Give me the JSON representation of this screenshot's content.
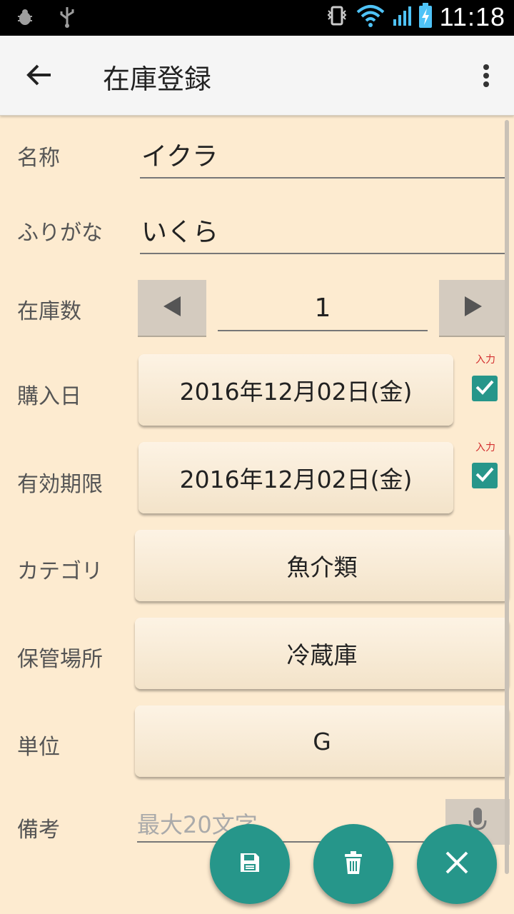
{
  "status_bar": {
    "time": "11:18"
  },
  "app_bar": {
    "title": "在庫登録"
  },
  "form": {
    "name": {
      "label": "名称",
      "value": "イクラ"
    },
    "furigana": {
      "label": "ふりがな",
      "value": "いくら"
    },
    "stock": {
      "label": "在庫数",
      "value": "1"
    },
    "purchase_date": {
      "label": "購入日",
      "value": "2016年12月02日(金)",
      "input_label": "入力",
      "checked": true
    },
    "expiry_date": {
      "label": "有効期限",
      "value": "2016年12月02日(金)",
      "input_label": "入力",
      "checked": true
    },
    "category": {
      "label": "カテゴリ",
      "value": "魚介類"
    },
    "storage": {
      "label": "保管場所",
      "value": "冷蔵庫"
    },
    "unit": {
      "label": "単位",
      "value": "G"
    },
    "memo": {
      "label": "備考",
      "placeholder": "最大20文字"
    }
  },
  "colors": {
    "accent": "#26968a",
    "background": "#fdebd0",
    "button": "#f7ead6",
    "required": "#d32f2f"
  },
  "icons": {
    "back": "arrow-left-icon",
    "menu": "more-vert-icon",
    "save": "floppy-disk-icon",
    "delete": "trash-icon",
    "close": "close-icon",
    "mic": "microphone-icon"
  }
}
